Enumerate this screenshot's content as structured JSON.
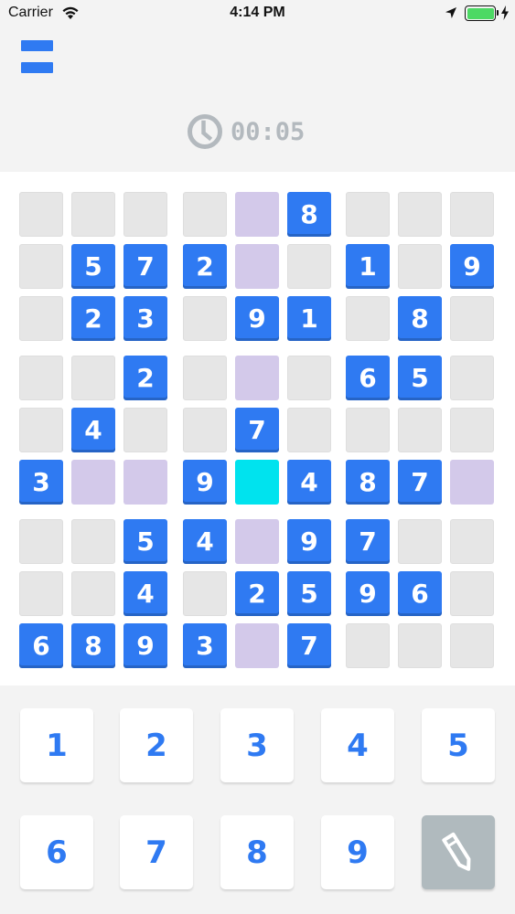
{
  "status_bar": {
    "carrier": "Carrier",
    "time": "4:14 PM"
  },
  "timer": {
    "value": "00:05"
  },
  "board": {
    "cells": [
      [
        "",
        "",
        "",
        "",
        "",
        "8",
        "",
        "",
        ""
      ],
      [
        "",
        "5",
        "7",
        "2",
        "",
        "",
        "1",
        "",
        "9"
      ],
      [
        "",
        "2",
        "3",
        "",
        "9",
        "1",
        "",
        "8",
        ""
      ],
      [
        "",
        "",
        "2",
        "",
        "",
        "",
        "6",
        "5",
        ""
      ],
      [
        "",
        "4",
        "",
        "",
        "7",
        "",
        "",
        "",
        ""
      ],
      [
        "3",
        "",
        "",
        "9",
        "",
        "4",
        "8",
        "7",
        ""
      ],
      [
        "",
        "",
        "5",
        "4",
        "",
        "9",
        "7",
        "",
        ""
      ],
      [
        "",
        "",
        "4",
        "",
        "2",
        "5",
        "9",
        "6",
        ""
      ],
      [
        "6",
        "8",
        "9",
        "3",
        "",
        "7",
        "",
        "",
        ""
      ]
    ],
    "selected": {
      "row": 5,
      "col": 4
    },
    "colors": {
      "given": "#2f7af2",
      "empty": "#e6e6e6",
      "highlight": "#d3c9ea",
      "selected": "#00e3ee"
    }
  },
  "keypad": {
    "keys": [
      "1",
      "2",
      "3",
      "4",
      "5",
      "6",
      "7",
      "8",
      "9"
    ],
    "pencil_icon": "pencil-icon"
  },
  "icons": {
    "menu": "hamburger-menu-icon",
    "timer": "clock-icon"
  }
}
